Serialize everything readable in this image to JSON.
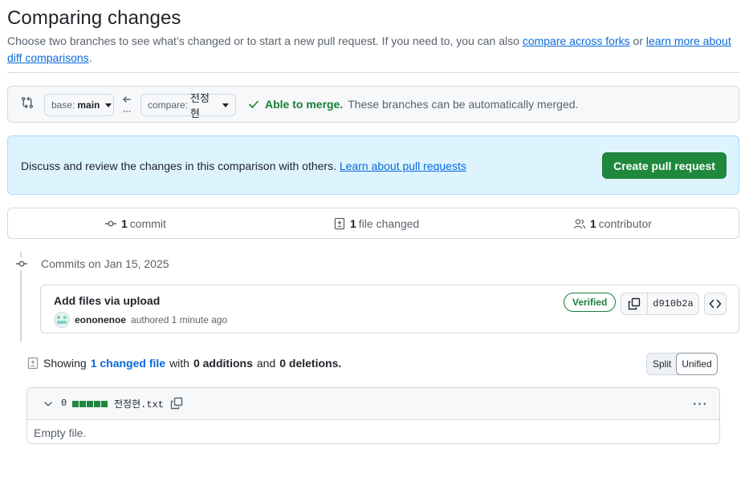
{
  "header": {
    "title": "Comparing changes",
    "subtitle_prefix": "Choose two branches to see what’s changed or to start a new pull request. If you need to, you can also ",
    "link_forks": "compare across forks",
    "subtitle_or": " or ",
    "link_learn": "learn more about diff comparisons",
    "subtitle_end": "."
  },
  "range": {
    "base_prefix": "base:",
    "base_branch": "main",
    "compare_prefix": "compare:",
    "compare_branch": "전정현",
    "merge_status": "Able to merge.",
    "merge_detail": "These branches can be automatically merged."
  },
  "discuss": {
    "text": "Discuss and review the changes in this comparison with others.",
    "link": "Learn about pull requests",
    "button": "Create pull request"
  },
  "summary": {
    "commits_count": "1",
    "commits_label": "commit",
    "files_count": "1",
    "files_label": "file changed",
    "contributors_count": "1",
    "contributors_label": "contributor"
  },
  "commits": {
    "heading": "Commits on Jan 15, 2025",
    "items": [
      {
        "title": "Add files via upload",
        "author": "eononenoe",
        "action": "authored 1 minute ago",
        "badge": "Verified",
        "sha": "d910b2a"
      }
    ]
  },
  "files_summary": {
    "showing": "Showing",
    "changed_link": "1 changed file",
    "with": "with",
    "additions": "0 additions",
    "and": "and",
    "deletions": "0 deletions.",
    "split": "Split",
    "unified": "Unified"
  },
  "file": {
    "changes": "0",
    "name": "전정현.txt",
    "body": "Empty file."
  },
  "colors": {
    "accent": "#0969da",
    "success": "#1a7f37",
    "primary_button": "#1f883d",
    "flash_bg": "#ddf4ff"
  }
}
